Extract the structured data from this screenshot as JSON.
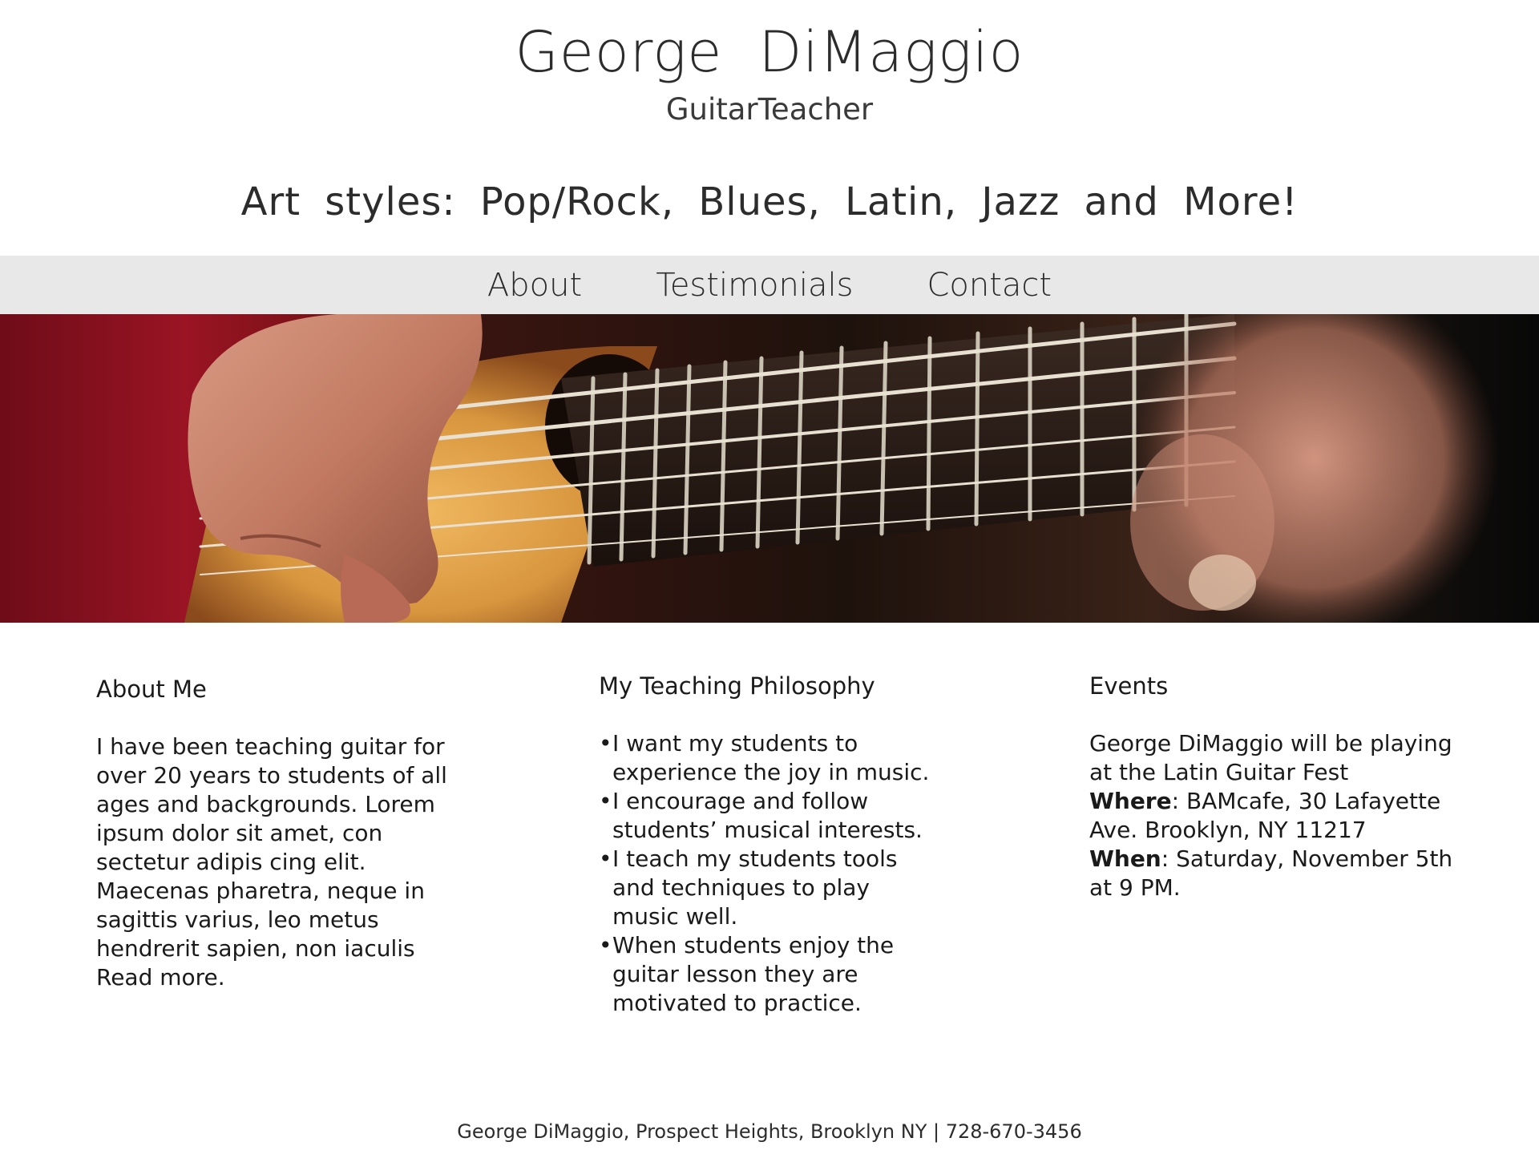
{
  "header": {
    "title": "George  DiMaggio",
    "subtitle": "GuitarTeacher",
    "tagline": "Art  styles:  Pop/Rock,  Blues,  Latin,  Jazz  and  More!"
  },
  "nav": {
    "items": [
      {
        "label": "About"
      },
      {
        "label": "Testimonials"
      },
      {
        "label": "Contact"
      }
    ]
  },
  "hero": {
    "image": "guitar-playing-photo",
    "colors": {
      "background": "#8a1020",
      "guitar_body": "#d99a48",
      "fretboard": "#2a1810",
      "skin": "#c9806a"
    }
  },
  "about": {
    "heading": "About Me",
    "body": "I have been teaching guitar for over 20 years to students of all ages and backgrounds. Lorem ipsum dolor sit amet, con sectetur adipis cing elit. Maecenas pharetra, neque in sagittis varius, leo metus hendrerit sapien, non iaculis Read more."
  },
  "philosophy": {
    "heading": "My Teaching Philosophy",
    "bullet_symbol": "•",
    "bullets": [
      "I want my students to experience the joy in music.",
      "I encourage and follow students’ musical interests.",
      "I teach my students tools and techniques to play music well.",
      "When students enjoy the guitar lesson they are motivated to practice."
    ]
  },
  "events": {
    "heading": "Events",
    "intro": "George DiMaggio will be playing at the Latin Guitar Fest",
    "where_label": "Where",
    "where_value": ": BAMcafe, 30 Lafayette Ave. Brooklyn, NY 11217",
    "when_label": "When",
    "when_value": ": Saturday, November 5th at 9 PM."
  },
  "footer": {
    "text": "George DiMaggio, Prospect Heights, Brooklyn NY | 728-670-3456"
  }
}
